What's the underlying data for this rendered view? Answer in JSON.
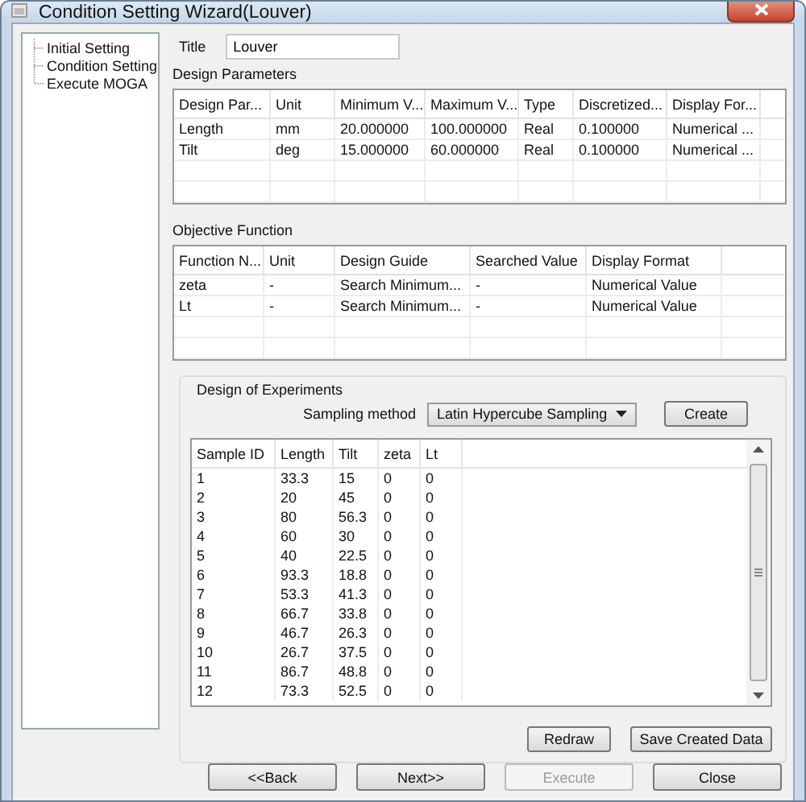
{
  "window": {
    "title": "Condition Setting Wizard(Louver)"
  },
  "tree": {
    "items": [
      {
        "label": "Initial Setting"
      },
      {
        "label": "Condition Setting"
      },
      {
        "label": "Execute MOGA"
      }
    ]
  },
  "title_field": {
    "label": "Title",
    "value": "Louver"
  },
  "design_parameters": {
    "label": "Design Parameters",
    "columns": [
      "Design Par...",
      "Unit",
      "Minimum V...",
      "Maximum V...",
      "Type",
      "Discretized...",
      "Display For..."
    ],
    "rows": [
      [
        "Length",
        "mm",
        "20.000000",
        "100.000000",
        "Real",
        "0.100000",
        "Numerical ..."
      ],
      [
        "Tilt",
        "deg",
        "15.000000",
        "60.000000",
        "Real",
        "0.100000",
        "Numerical ..."
      ]
    ]
  },
  "objective_function": {
    "label": "Objective Function",
    "columns": [
      "Function N...",
      "Unit",
      "Design Guide",
      "Searched Value",
      "Display Format"
    ],
    "rows": [
      [
        "zeta",
        "-",
        "Search Minimum...",
        "-",
        "Numerical Value"
      ],
      [
        "Lt",
        "-",
        "Search Minimum...",
        "-",
        "Numerical Value"
      ]
    ]
  },
  "design_of_experiments": {
    "label": "Design of Experiments",
    "sampling_label": "Sampling method",
    "sampling_value": "Latin Hypercube Sampling",
    "create_button": "Create",
    "columns": [
      "Sample ID",
      "Length",
      "Tilt",
      "zeta",
      "Lt"
    ],
    "rows": [
      [
        "1",
        "33.3",
        "15",
        "0",
        "0"
      ],
      [
        "2",
        "20",
        "45",
        "0",
        "0"
      ],
      [
        "3",
        "80",
        "56.3",
        "0",
        "0"
      ],
      [
        "4",
        "60",
        "30",
        "0",
        "0"
      ],
      [
        "5",
        "40",
        "22.5",
        "0",
        "0"
      ],
      [
        "6",
        "93.3",
        "18.8",
        "0",
        "0"
      ],
      [
        "7",
        "53.3",
        "41.3",
        "0",
        "0"
      ],
      [
        "8",
        "66.7",
        "33.8",
        "0",
        "0"
      ],
      [
        "9",
        "46.7",
        "26.3",
        "0",
        "0"
      ],
      [
        "10",
        "26.7",
        "37.5",
        "0",
        "0"
      ],
      [
        "11",
        "86.7",
        "48.8",
        "0",
        "0"
      ],
      [
        "12",
        "73.3",
        "52.5",
        "0",
        "0"
      ]
    ],
    "buttons": [
      "Redraw",
      "Save Created Data"
    ]
  },
  "footer_buttons": [
    {
      "label": "<<Back",
      "disabled": false
    },
    {
      "label": "Next>>",
      "disabled": false
    },
    {
      "label": "Execute",
      "disabled": true
    },
    {
      "label": "Close",
      "disabled": false
    }
  ]
}
